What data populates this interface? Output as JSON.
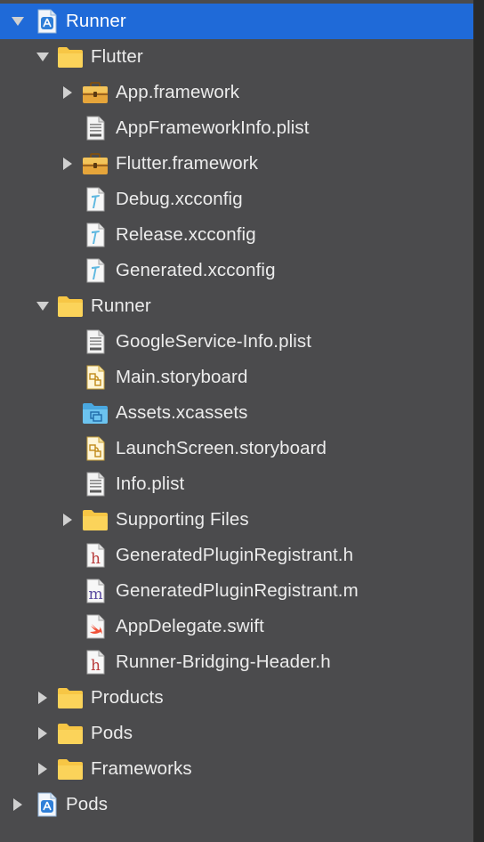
{
  "navigator": {
    "items": [
      {
        "label": "Runner",
        "icon": "xcode-project-icon",
        "disclosure": "expanded",
        "selected": true
      },
      {
        "label": "Flutter",
        "icon": "folder-icon",
        "disclosure": "expanded"
      },
      {
        "label": "App.framework",
        "icon": "framework-icon",
        "disclosure": "collapsed"
      },
      {
        "label": "AppFrameworkInfo.plist",
        "icon": "plist-file-icon",
        "disclosure": "none"
      },
      {
        "label": "Flutter.framework",
        "icon": "framework-icon",
        "disclosure": "collapsed"
      },
      {
        "label": "Debug.xcconfig",
        "icon": "xcconfig-file-icon",
        "disclosure": "none"
      },
      {
        "label": "Release.xcconfig",
        "icon": "xcconfig-file-icon",
        "disclosure": "none"
      },
      {
        "label": "Generated.xcconfig",
        "icon": "xcconfig-file-icon",
        "disclosure": "none"
      },
      {
        "label": "Runner",
        "icon": "folder-icon",
        "disclosure": "expanded"
      },
      {
        "label": "GoogleService-Info.plist",
        "icon": "plist-file-icon",
        "disclosure": "none"
      },
      {
        "label": "Main.storyboard",
        "icon": "storyboard-file-icon",
        "disclosure": "none"
      },
      {
        "label": "Assets.xcassets",
        "icon": "asset-catalog-icon",
        "disclosure": "none"
      },
      {
        "label": "LaunchScreen.storyboard",
        "icon": "storyboard-file-icon",
        "disclosure": "none"
      },
      {
        "label": "Info.plist",
        "icon": "plist-file-icon",
        "disclosure": "none"
      },
      {
        "label": "Supporting Files",
        "icon": "folder-icon",
        "disclosure": "collapsed"
      },
      {
        "label": "GeneratedPluginRegistrant.h",
        "icon": "header-file-icon",
        "disclosure": "none"
      },
      {
        "label": "GeneratedPluginRegistrant.m",
        "icon": "objc-file-icon",
        "disclosure": "none"
      },
      {
        "label": "AppDelegate.swift",
        "icon": "swift-file-icon",
        "disclosure": "none"
      },
      {
        "label": "Runner-Bridging-Header.h",
        "icon": "header-file-icon",
        "disclosure": "none"
      },
      {
        "label": "Products",
        "icon": "folder-icon",
        "disclosure": "collapsed"
      },
      {
        "label": "Pods",
        "icon": "folder-icon",
        "disclosure": "collapsed"
      },
      {
        "label": "Frameworks",
        "icon": "folder-icon",
        "disclosure": "collapsed"
      },
      {
        "label": "Pods",
        "icon": "xcode-project-icon",
        "disclosure": "collapsed"
      }
    ]
  },
  "colors": {
    "selection": "#1f6ad8",
    "background": "#4b4b4d",
    "text": "#ececec",
    "folder": "#f7c645",
    "header_letter": "#b83a3a",
    "objc_letter": "#5a4aa0",
    "swift_orange": "#f05138",
    "xcconfig_blue": "#5fb8e0"
  }
}
